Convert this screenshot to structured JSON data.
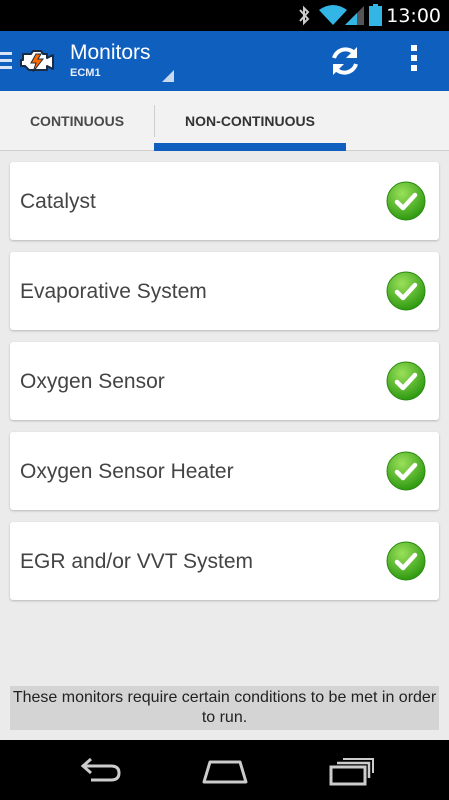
{
  "status_bar": {
    "time": "13:00",
    "icons": [
      "bluetooth-icon",
      "wifi-icon",
      "signal-icon",
      "battery-icon"
    ]
  },
  "action_bar": {
    "title": "Monitors",
    "subtitle": "ECM1",
    "actions": [
      "refresh-icon",
      "overflow-menu-icon"
    ]
  },
  "tabs": [
    {
      "label": "CONTINUOUS",
      "selected": false
    },
    {
      "label": "NON-CONTINUOUS",
      "selected": true
    }
  ],
  "monitors": [
    {
      "label": "Catalyst",
      "status": "complete"
    },
    {
      "label": "Evaporative System",
      "status": "complete"
    },
    {
      "label": "Oxygen Sensor",
      "status": "complete"
    },
    {
      "label": "Oxygen Sensor Heater",
      "status": "complete"
    },
    {
      "label": "EGR and/or VVT System",
      "status": "complete"
    }
  ],
  "note": "These monitors require certain conditions to be met in order to run.",
  "nav_bar": [
    "back-icon",
    "home-icon",
    "recent-apps-icon"
  ],
  "colors": {
    "action_bar": "#0f5fbf",
    "tab_indicator": "#0f5fbf",
    "check_green": "#3fae1c"
  }
}
